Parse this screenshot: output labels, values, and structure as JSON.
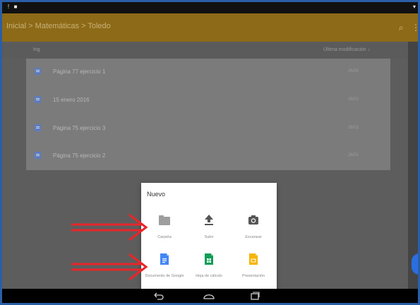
{
  "status_bar": {
    "left_icons": [
      "notification-icon",
      "image-icon"
    ],
    "right_icon": "wifi-icon"
  },
  "app_bar": {
    "breadcrumb": "Inicial > Matemáticas > Toledo",
    "icons": [
      "search-icon",
      "more-icon"
    ],
    "color": "#8d6a17"
  },
  "list_header": {
    "name_label": "Ing",
    "sort_label": "Última modificación ↓"
  },
  "files": [
    {
      "name": "Página 77 ejercicio 1",
      "modified": "26/05"
    },
    {
      "name": "15 enero 2016",
      "modified": "26/01"
    },
    {
      "name": "Página 75 ejercicio 3",
      "modified": "26/01"
    },
    {
      "name": "Página 75 ejercicio 2",
      "modified": "26/01"
    }
  ],
  "dialog": {
    "title": "Nuevo",
    "options": [
      {
        "label": "Carpeta",
        "icon": "folder-icon",
        "color": "#9e9e9e"
      },
      {
        "label": "Subir",
        "icon": "upload-icon",
        "color": "#555555"
      },
      {
        "label": "Escanear",
        "icon": "camera-icon",
        "color": "#555555"
      },
      {
        "label": "Documento de Google",
        "icon": "google-doc-icon",
        "color": "#4285f4"
      },
      {
        "label": "Hoja de cálculo",
        "icon": "google-sheet-icon",
        "color": "#0f9d58"
      },
      {
        "label": "Presentación",
        "icon": "google-slides-icon",
        "color": "#f4b400"
      }
    ]
  },
  "nav_bar": {
    "buttons": [
      "back-icon",
      "home-icon",
      "recents-icon"
    ]
  },
  "annotation_color": "#e8262a"
}
